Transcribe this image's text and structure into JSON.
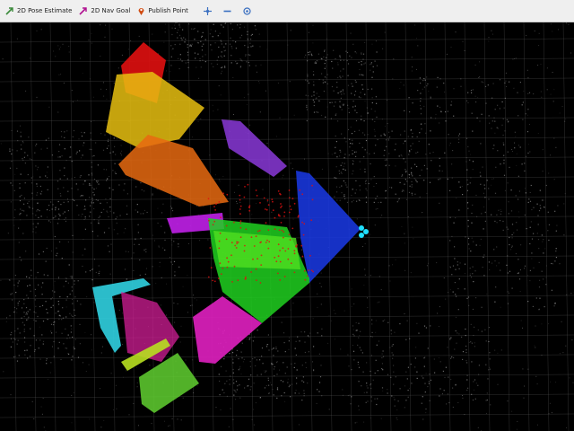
{
  "toolbar": {
    "tools": [
      {
        "label": "2D Pose Estimate",
        "icon": "pose-estimate-arrow-icon",
        "color": "#3a8a3a"
      },
      {
        "label": "2D Nav Goal",
        "icon": "nav-goal-arrow-icon",
        "color": "#b01090"
      },
      {
        "label": "Publish Point",
        "icon": "map-pin-icon",
        "color": "#d04a10"
      }
    ],
    "view_tools": [
      {
        "icon": "move-camera-icon"
      },
      {
        "icon": "zoom-out-icon"
      },
      {
        "icon": "focus-camera-icon"
      }
    ]
  },
  "viewport": {
    "background": "#000000",
    "grid_color": "#5a5a5a",
    "point_cloud_color": "#9a9a9a",
    "footprint_colors": [
      "#e01010",
      "#e8c010",
      "#e86a10",
      "#8a38d8",
      "#1a3ae8",
      "#c020e8",
      "#20d020",
      "#50e020",
      "#e020c0",
      "#30d0e0",
      "#b8e020",
      "#60d030"
    ],
    "sensor_marker_color": "#20e0ff"
  }
}
